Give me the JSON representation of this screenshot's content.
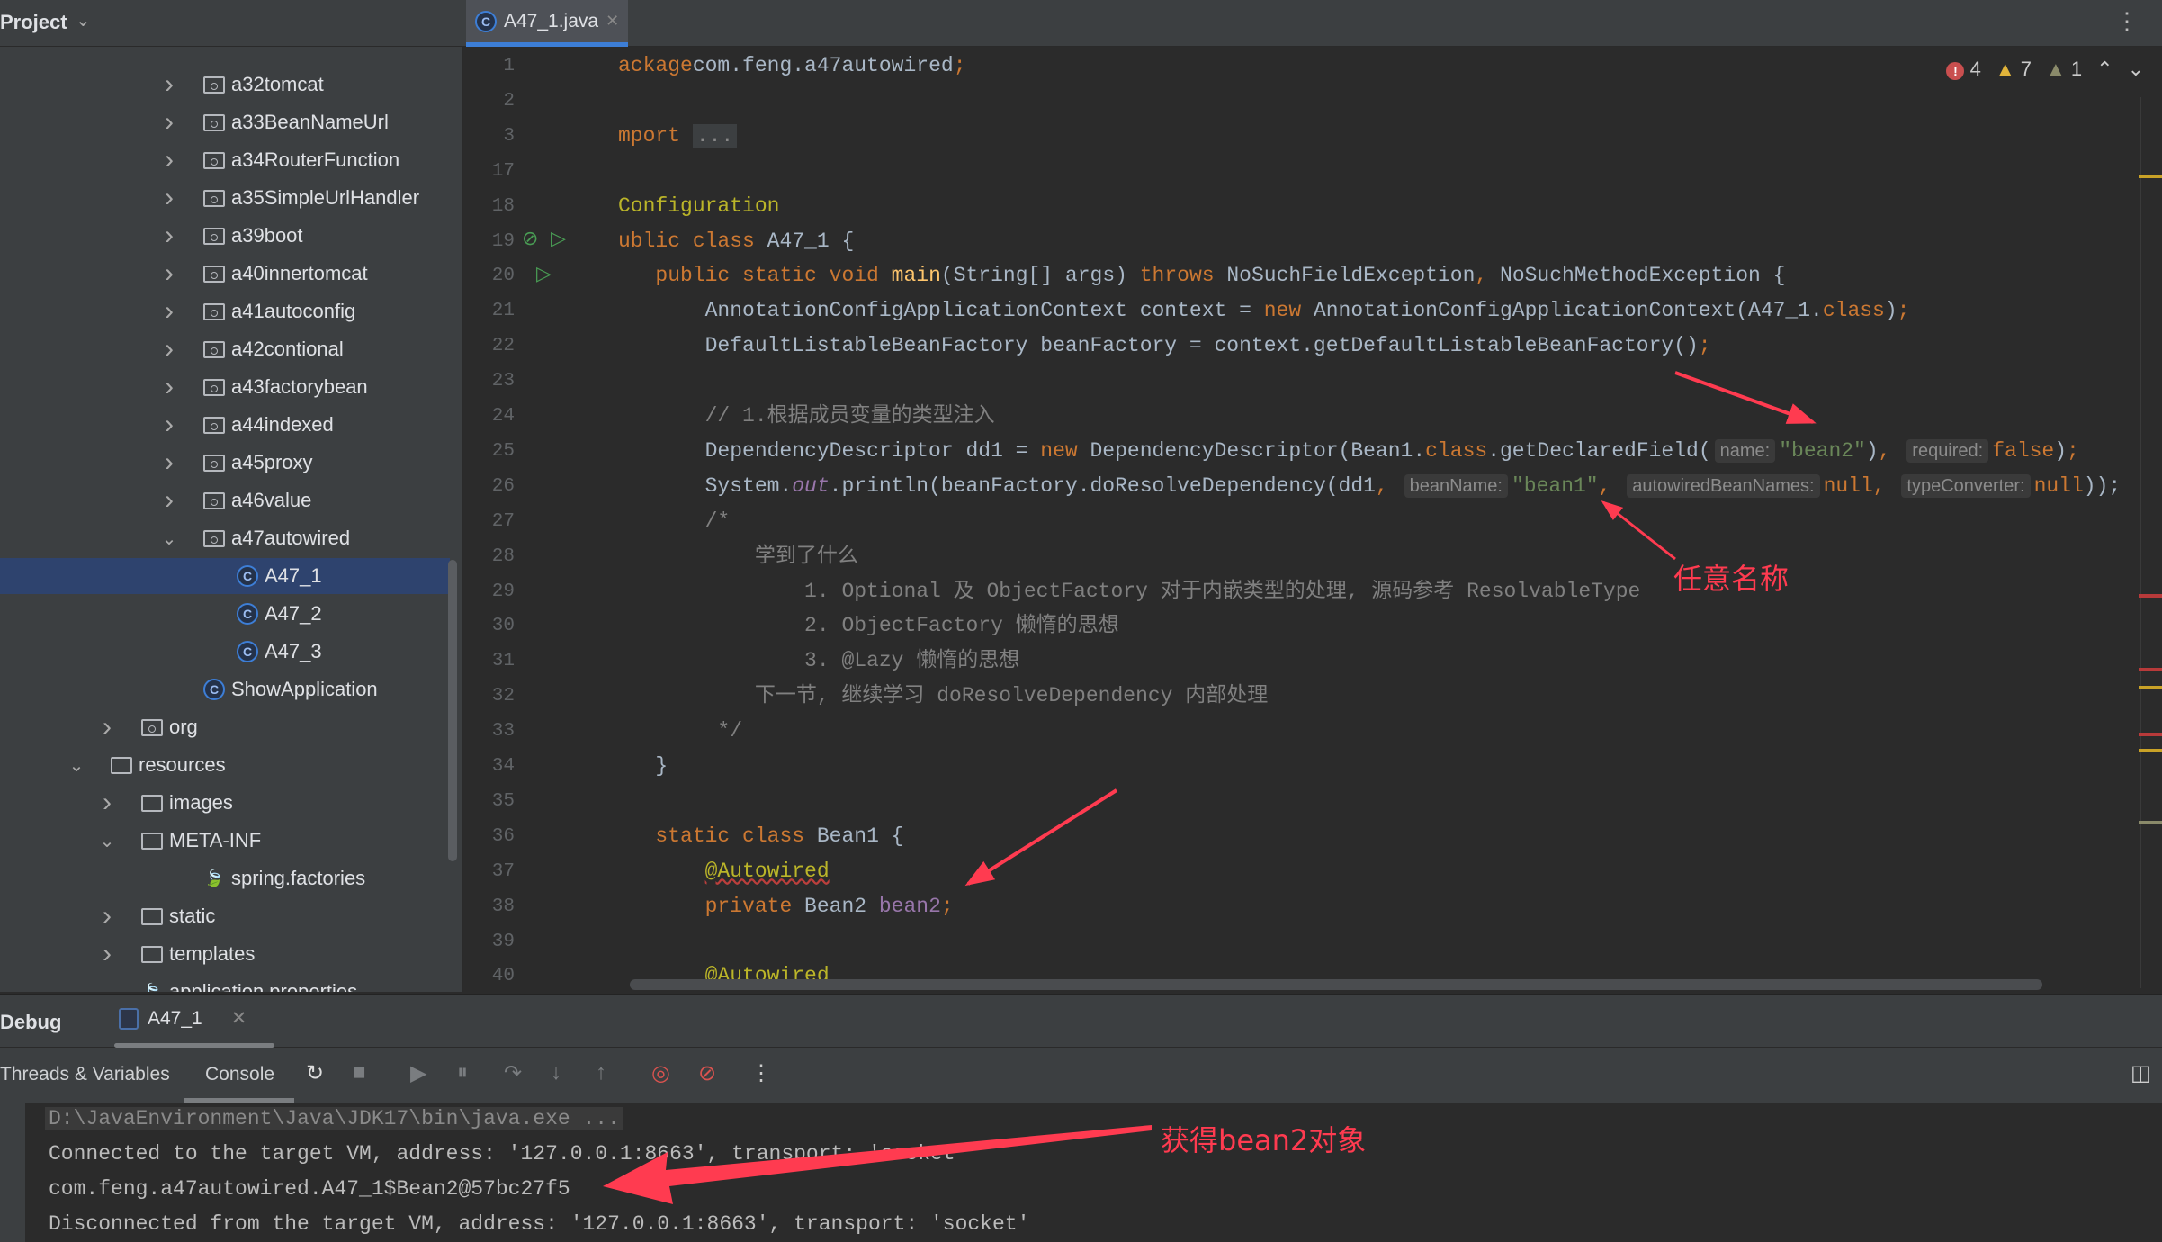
{
  "project": {
    "title": "Project",
    "tree": [
      {
        "label": "a32tomcat",
        "type": "package",
        "level": 3,
        "expanded": false
      },
      {
        "label": "a33BeanNameUrl",
        "type": "package",
        "level": 3,
        "expanded": false
      },
      {
        "label": "a34RouterFunction",
        "type": "package",
        "level": 3,
        "expanded": false
      },
      {
        "label": "a35SimpleUrlHandler",
        "type": "package",
        "level": 3,
        "expanded": false
      },
      {
        "label": "a39boot",
        "type": "package",
        "level": 3,
        "expanded": false
      },
      {
        "label": "a40innertomcat",
        "type": "package",
        "level": 3,
        "expanded": false
      },
      {
        "label": "a41autoconfig",
        "type": "package",
        "level": 3,
        "expanded": false
      },
      {
        "label": "a42contional",
        "type": "package",
        "level": 3,
        "expanded": false
      },
      {
        "label": "a43factorybean",
        "type": "package",
        "level": 3,
        "expanded": false
      },
      {
        "label": "a44indexed",
        "type": "package",
        "level": 3,
        "expanded": false
      },
      {
        "label": "a45proxy",
        "type": "package",
        "level": 3,
        "expanded": false
      },
      {
        "label": "a46value",
        "type": "package",
        "level": 3,
        "expanded": false
      },
      {
        "label": "a47autowired",
        "type": "package",
        "level": 3,
        "expanded": true
      },
      {
        "label": "A47_1",
        "type": "class",
        "level": 4,
        "selected": true
      },
      {
        "label": "A47_2",
        "type": "class",
        "level": 4
      },
      {
        "label": "A47_3",
        "type": "class",
        "level": 4
      },
      {
        "label": "ShowApplication",
        "type": "app",
        "level": 3
      },
      {
        "label": "org",
        "type": "package",
        "level": 2,
        "expanded": false
      },
      {
        "label": "resources",
        "type": "resources",
        "level": 1,
        "expanded": true
      },
      {
        "label": "images",
        "type": "folder",
        "level": 2,
        "expanded": false
      },
      {
        "label": "META-INF",
        "type": "folder",
        "level": 2,
        "expanded": true
      },
      {
        "label": "spring.factories",
        "type": "spring",
        "level": 3
      },
      {
        "label": "static",
        "type": "folder",
        "level": 2,
        "expanded": false
      },
      {
        "label": "templates",
        "type": "folder",
        "level": 2,
        "expanded": false
      },
      {
        "label": "application.properties",
        "type": "spring",
        "level": 2
      }
    ]
  },
  "editor": {
    "tab_label": "A47_1.java",
    "inspections": {
      "errors": "4",
      "warnings": "7",
      "weak_warnings": "1"
    },
    "lines": [
      {
        "n": "1",
        "t": [
          [
            "kw",
            "ackage"
          ],
          [
            "",
            "com.feng.a47autowired"
          ],
          [
            "kw",
            ";"
          ]
        ]
      },
      {
        "n": "2",
        "t": []
      },
      {
        "n": "3",
        "t": [
          [
            "kw",
            "mport "
          ],
          [
            "fold",
            "..."
          ]
        ]
      },
      {
        "n": "17",
        "t": []
      },
      {
        "n": "18",
        "t": [
          [
            "ann",
            "Configuration"
          ]
        ]
      },
      {
        "n": "19",
        "t": [
          [
            "kw",
            "ublic class "
          ],
          [
            "",
            "A47_1 {"
          ]
        ]
      },
      {
        "n": "20",
        "t": [
          [
            "",
            "   "
          ],
          [
            "kw",
            "public static void "
          ],
          [
            "fn",
            "main"
          ],
          [
            "",
            "(String[] args) "
          ],
          [
            "kw",
            "throws "
          ],
          [
            "",
            "NoSuchFieldException"
          ],
          [
            "kw",
            ", "
          ],
          [
            "",
            "NoSuchMethodException {"
          ]
        ]
      },
      {
        "n": "21",
        "t": [
          [
            "",
            "       AnnotationConfigApplicationContext context = "
          ],
          [
            "kw",
            "new "
          ],
          [
            "",
            "AnnotationConfigApplicationContext(A47_1."
          ],
          [
            "kw",
            "class"
          ],
          [
            "",
            ")"
          ],
          [
            "kw",
            ";"
          ]
        ]
      },
      {
        "n": "22",
        "t": [
          [
            "",
            "       DefaultListableBeanFactory beanFactory = context.getDefaultListableBeanFactory()"
          ],
          [
            "kw",
            ";"
          ]
        ]
      },
      {
        "n": "23",
        "t": []
      },
      {
        "n": "24",
        "t": [
          [
            "cmt",
            "       // 1.根据成员变量的类型注入"
          ]
        ]
      },
      {
        "n": "25",
        "t": [
          [
            "",
            "       DependencyDescriptor dd1 = "
          ],
          [
            "kw",
            "new "
          ],
          [
            "",
            "DependencyDescriptor(Bean1."
          ],
          [
            "kw",
            "class"
          ],
          [
            "",
            ".getDeclaredField("
          ],
          [
            "hint",
            "name:"
          ],
          [
            "str",
            "\"bean2\""
          ],
          [
            "",
            ")"
          ],
          [
            "kw",
            ", "
          ],
          [
            "hint",
            "required:"
          ],
          [
            "kw",
            "false"
          ],
          [
            "",
            ")"
          ],
          [
            "kw",
            ";"
          ]
        ]
      },
      {
        "n": "26",
        "t": [
          [
            "",
            "       System."
          ],
          [
            "pur it",
            "out"
          ],
          [
            "",
            ".println(beanFactory.doResolveDependency(dd1"
          ],
          [
            "kw",
            ", "
          ],
          [
            "hint",
            "beanName:"
          ],
          [
            "str",
            "\"bean1\""
          ],
          [
            "kw",
            ", "
          ],
          [
            "hint",
            "autowiredBeanNames:"
          ],
          [
            "kw",
            "null, "
          ],
          [
            "hint",
            "typeConverter:"
          ],
          [
            "kw",
            "null"
          ],
          [
            "",
            "));"
          ]
        ]
      },
      {
        "n": "27",
        "t": [
          [
            "cmt",
            "       /*"
          ]
        ]
      },
      {
        "n": "28",
        "t": [
          [
            "cmt",
            "           学到了什么"
          ]
        ]
      },
      {
        "n": "29",
        "t": [
          [
            "cmt",
            "               1. Optional 及 ObjectFactory 对于内嵌类型的处理, 源码参考 ResolvableType"
          ]
        ]
      },
      {
        "n": "30",
        "t": [
          [
            "cmt",
            "               2. ObjectFactory 懒惰的思想"
          ]
        ]
      },
      {
        "n": "31",
        "t": [
          [
            "cmt",
            "               3. @Lazy 懒惰的思想"
          ]
        ]
      },
      {
        "n": "32",
        "t": [
          [
            "cmt",
            "           下一节, 继续学习 doResolveDependency 内部处理"
          ]
        ]
      },
      {
        "n": "33",
        "t": [
          [
            "cmt",
            "        */"
          ]
        ]
      },
      {
        "n": "34",
        "t": [
          [
            "",
            "   }"
          ]
        ]
      },
      {
        "n": "35",
        "t": []
      },
      {
        "n": "36",
        "t": [
          [
            "",
            "   "
          ],
          [
            "kw",
            "static class "
          ],
          [
            "",
            "Bean1 {"
          ]
        ]
      },
      {
        "n": "37",
        "t": [
          [
            "",
            "       "
          ],
          [
            "ann squig",
            "@Autowired"
          ]
        ]
      },
      {
        "n": "38",
        "t": [
          [
            "",
            "       "
          ],
          [
            "kw",
            "private "
          ],
          [
            "",
            "Bean2 "
          ],
          [
            "pur",
            "bean2"
          ],
          [
            "kw",
            ";"
          ]
        ]
      },
      {
        "n": "39",
        "t": []
      },
      {
        "n": "40",
        "t": [
          [
            "",
            "       "
          ],
          [
            "ann squig",
            "@Autowired"
          ]
        ]
      }
    ]
  },
  "debug": {
    "title": "Debug",
    "tab_label": "A47_1",
    "tabs": [
      "Threads & Variables",
      "Console"
    ],
    "console": [
      "D:\\JavaEnvironment\\Java\\JDK17\\bin\\java.exe ...",
      "Connected to the target VM, address: '127.0.0.1:8663', transport: 'socket'",
      "com.feng.a47autowired.A47_1$Bean2@57bc27f5",
      "Disconnected from the target VM, address: '127.0.0.1:8663', transport: 'socket'"
    ]
  },
  "annotations": {
    "any_name": "任意名称",
    "got_bean2": "获得bean2对象",
    "color": "#ff3b50"
  },
  "colors": {
    "accent": "#3d7ed6",
    "keyword": "#cc7832",
    "string": "#6a8759",
    "annotation": "#bbb529",
    "comment": "#808080"
  }
}
